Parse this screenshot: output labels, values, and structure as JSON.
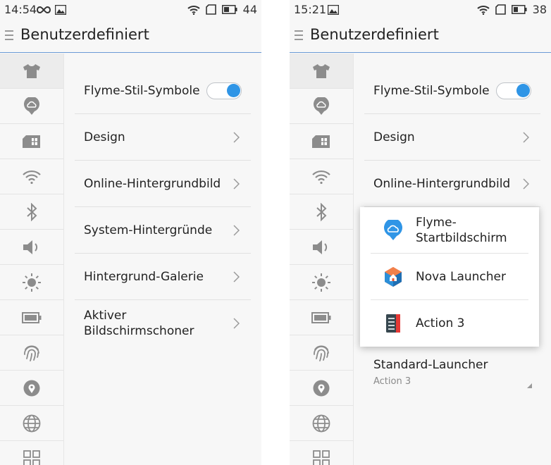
{
  "left": {
    "status": {
      "time": "14:54",
      "battery": "44"
    },
    "title": "Benutzerdefiniert",
    "toggle_label": "Flyme-Stil-Symbole",
    "toggle_on": true,
    "menu": [
      "Design",
      "Online-Hintergrundbild",
      "System-Hintergründe",
      "Hintergrund-Galerie",
      "Aktiver Bildschirmschoner"
    ]
  },
  "right": {
    "status": {
      "time": "15:21",
      "battery": "38"
    },
    "title": "Benutzerdefiniert",
    "toggle_label": "Flyme-Stil-Symbole",
    "toggle_on": true,
    "menu": [
      "Design",
      "Online-Hintergrundbild"
    ],
    "popup": [
      "Flyme-Startbildschirm",
      "Nova Launcher",
      "Action 3"
    ],
    "launcher": {
      "title": "Standard-Launcher",
      "value": "Action 3"
    }
  },
  "sidebar_icons": [
    "shirt-icon",
    "cloud-icon",
    "sim-card-icon",
    "wifi-icon",
    "bluetooth-icon",
    "volume-icon",
    "brightness-icon",
    "battery-icon",
    "fingerprint-icon",
    "location-icon",
    "globe-icon",
    "apps-grid-icon"
  ],
  "colors": {
    "accent": "#2f95e6",
    "divider": "#6b9bd6",
    "icon_gray": "#8c8c8c"
  }
}
